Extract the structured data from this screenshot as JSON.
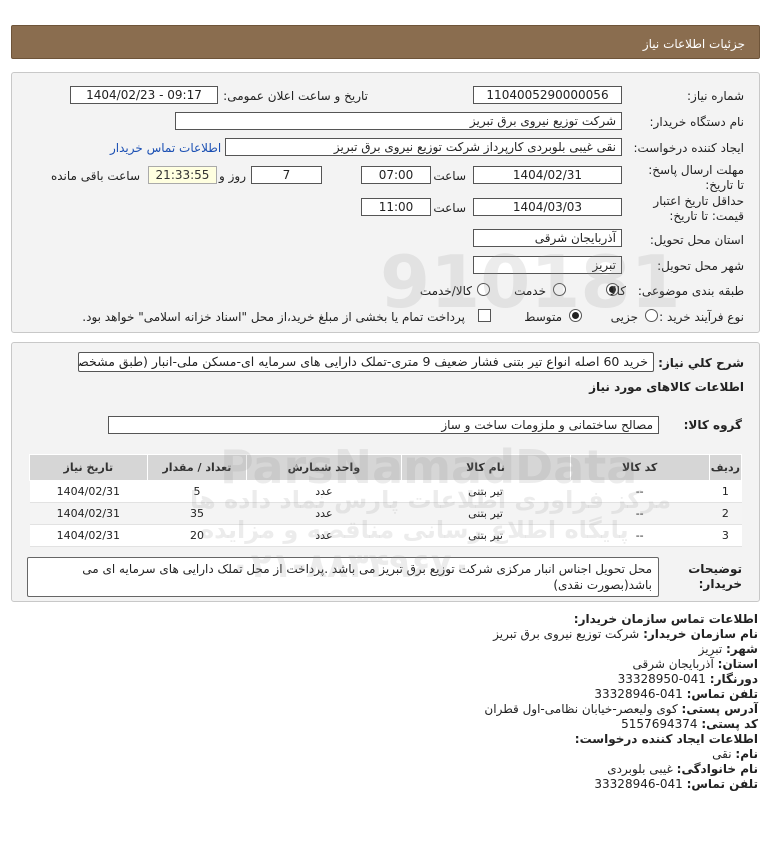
{
  "header": {
    "title": "جزئیات اطلاعات نیاز"
  },
  "form": {
    "need_number_label": "شماره نیاز:",
    "need_number": "1104005290000056",
    "announce_label": "تاریخ و ساعت اعلان عمومی:",
    "announce_value": "1404/02/23 - 09:17",
    "buyer_label": "نام دستگاه خریدار:",
    "buyer_value": "شرکت توزیع نیروی برق تبریز",
    "creator_label": "ایجاد کننده درخواست:",
    "creator_value": "نقی غیبی بلوبردی کارپرداز شرکت توزیع نیروی برق تبریز",
    "contact_link": "اطلاعات تماس خریدار",
    "deadline_label": "مهلت ارسال پاسخ: تا تاریخ:",
    "deadline_date": "1404/02/31",
    "time_label": "ساعت",
    "deadline_time": "07:00",
    "days_value": "7",
    "days_label": "روز و",
    "remaining_value": "21:33:55",
    "remaining_label": "ساعت باقی مانده",
    "validity_label": "حداقل تاریخ اعتبار قیمت: تا تاریخ:",
    "validity_date": "1404/03/03",
    "validity_time": "11:00",
    "province_label": "استان محل تحویل:",
    "province_value": "آذربایجان شرقی",
    "city_label": "شهر محل تحویل:",
    "city_value": "تبریز",
    "category_label": "طبقه بندی موضوعی:",
    "category_options": [
      "کالا",
      "خدمت",
      "کالا/خدمت"
    ],
    "category_selected": "کالا",
    "purchase_label": "نوع فرآیند خرید :",
    "purchase_options": [
      "جزیی",
      "متوسط"
    ],
    "purchase_selected": "متوسط",
    "payment_note": "پرداخت تمام یا بخشی از مبلغ خرید،از محل \"اسناد خزانه اسلامی\" خواهد بود."
  },
  "summary": {
    "label": "شرح کلي نياز:",
    "value": "خرید 60 اصله انواع تیر بتنی فشار ضعیف 9 متری-تملک دارایی های سرمایه ای-مسکن ملی-انبار (طبق مشخصات)"
  },
  "goods": {
    "section_title": "اطلاعات کالاهای مورد نیاز",
    "group_label": "گروه کالا:",
    "group_value": "مصالح ساختمانی و ملزومات ساخت  و ساز",
    "columns": [
      "ردیف",
      "کد کالا",
      "نام کالا",
      "واحد شمارش",
      "تعداد / مقدار",
      "تاریخ نیاز"
    ],
    "rows": [
      [
        "1",
        "--",
        "تیر بتنی",
        "عدد",
        "5",
        "1404/02/31"
      ],
      [
        "2",
        "--",
        "تیر بتنی",
        "عدد",
        "35",
        "1404/02/31"
      ],
      [
        "3",
        "--",
        "تیر بتنی",
        "عدد",
        "20",
        "1404/02/31"
      ]
    ]
  },
  "notes": {
    "label": "توضیحات خریدار:",
    "value": "محل تحویل اجناس انبار مرکزی شرکت توزیع برق تبریز می باشد .پرداخت از محل تملک دارایی های سرمایه ای می باشد(بصورت نقدی)"
  },
  "contact": {
    "title": "اطلاعات تماس سازمان خریدار:",
    "org_label": "نام سازمان خریدار:",
    "org_value": "شرکت توزیع نیروی برق تبریز",
    "city_label": "شهر:",
    "city_value": "تبریز",
    "province_label": "استان:",
    "province_value": "آذربایجان شرقی",
    "fax_label": "دورنگار:",
    "fax_value": "041-33328950",
    "phone_label": "تلفن تماس:",
    "phone_value": "041-33328946",
    "address_label": "آدرس پستی:",
    "address_value": "کوی ولیعصر-خیابان نظامی-اول قطران",
    "postal_label": "کد پستی:",
    "postal_value": "5157694374",
    "creator_title": "اطلاعات ایجاد کننده درخواست:",
    "name_label": "نام:",
    "name_value": "نقی",
    "family_label": "نام خانوادگی:",
    "family_value": "غیبی بلوبردی",
    "creator_phone_label": "تلفن تماس:",
    "creator_phone_value": "041-33328946"
  },
  "watermark": {
    "digits": "910181",
    "site": "ParsNamadData",
    "line1": "مرکز فراوری اطلاعات پارس نماد داده ها",
    "line2": "پایگاه اطلاع رسانی مناقصه و مزایده",
    "line3": "۰۲۱-۸۸۳۴۹۶۷۰"
  },
  "colors": {
    "titlebar": "#8a6d4f",
    "link": "#1a4fb3",
    "table_header": "#d6d6d6"
  }
}
